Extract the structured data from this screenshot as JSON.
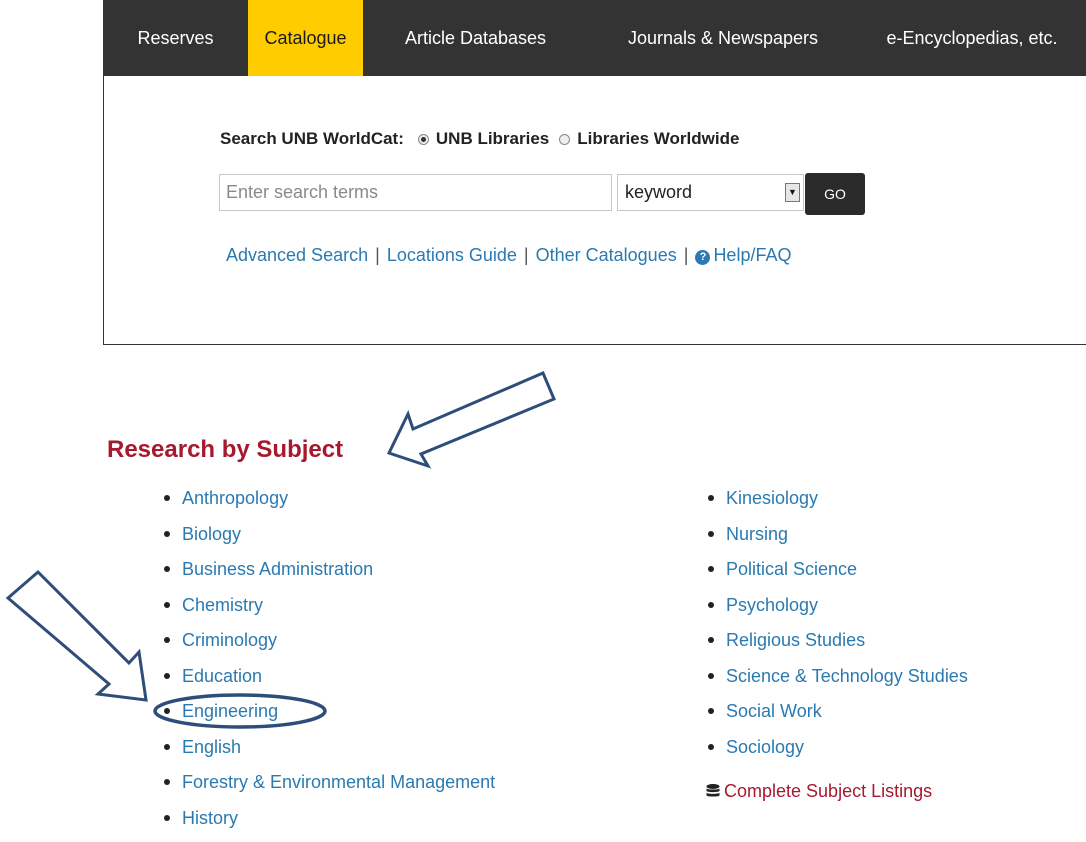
{
  "nav": {
    "tabs": [
      {
        "label": "Reserves",
        "active": false
      },
      {
        "label": "Catalogue",
        "active": true
      },
      {
        "label": "Article Databases",
        "active": false
      },
      {
        "label": "Journals & Newspapers",
        "active": false
      },
      {
        "label": "e-Encyclopedias, etc.",
        "active": false
      }
    ],
    "active_color": "#ffcc00",
    "bar_color": "#333333"
  },
  "search": {
    "label": "Search UNB WorldCat:",
    "scope_options": [
      {
        "label": "UNB Libraries",
        "selected": true
      },
      {
        "label": "Libraries Worldwide",
        "selected": false
      }
    ],
    "input_value": "",
    "placeholder": "Enter search terms",
    "field_type": "keyword",
    "go_label": "GO",
    "links": [
      {
        "label": "Advanced Search"
      },
      {
        "label": "Locations Guide"
      },
      {
        "label": "Other Catalogues"
      },
      {
        "label": "Help/FAQ",
        "icon": "help-icon"
      }
    ],
    "separator": "|"
  },
  "subjects": {
    "heading": "Research by Subject",
    "heading_color": "#a6192e",
    "link_color": "#2a7ab0",
    "left_column": [
      "Anthropology",
      "Biology",
      "Business Administration",
      "Chemistry",
      "Criminology",
      "Education",
      "Engineering",
      "English",
      "Forestry & Environmental Management",
      "History"
    ],
    "right_column": [
      "Kinesiology",
      "Nursing",
      "Political Science",
      "Psychology",
      "Religious Studies",
      "Science & Technology Studies",
      "Social Work",
      "Sociology"
    ],
    "complete_listings": {
      "label": "Complete Subject Listings",
      "icon": "database-icon"
    }
  },
  "annotations": {
    "highlighted_item": "Engineering",
    "color": "#2f4d7a"
  }
}
